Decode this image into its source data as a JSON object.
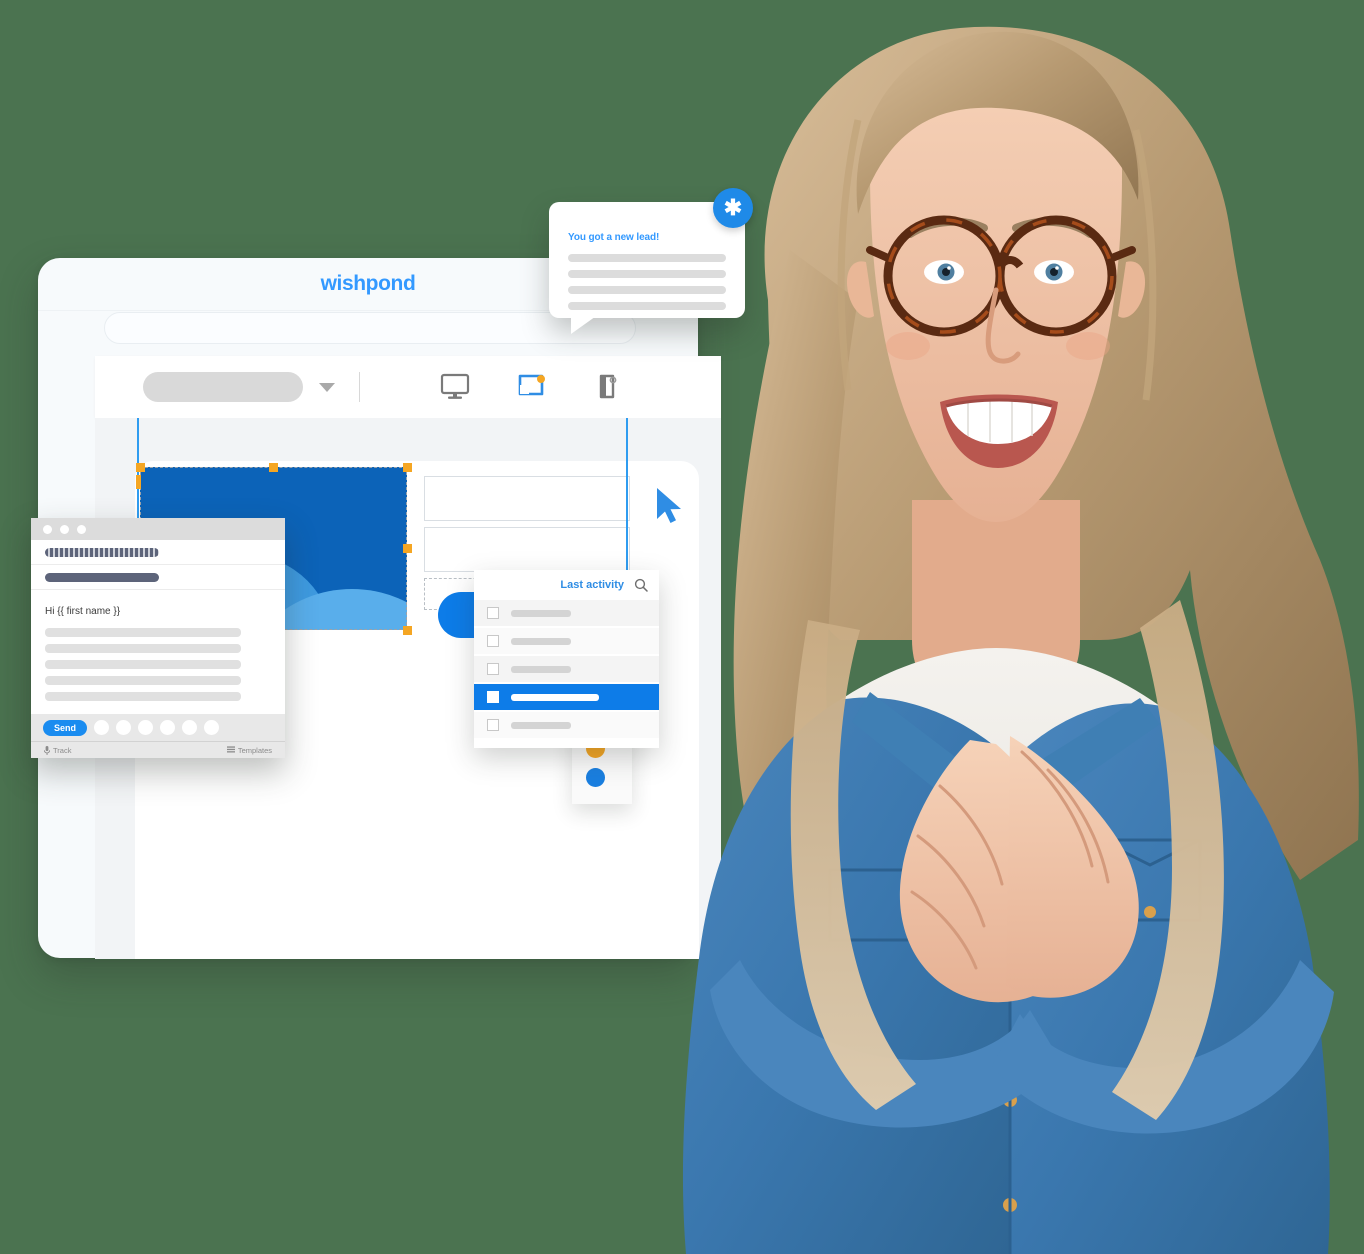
{
  "background_color": "#4b7350",
  "brand": {
    "name": "wishpond",
    "color": "#3399ff"
  },
  "main_window": {
    "logo": "wishpond",
    "url_placeholder": "",
    "toolbar": {
      "element_select_value": "",
      "chevron": "chevron-down-icon",
      "devices": [
        {
          "name": "desktop",
          "label": "Desktop",
          "active": false
        },
        {
          "name": "tablet",
          "label": "Tablet",
          "active": true
        },
        {
          "name": "mobile",
          "label": "Mobile",
          "active": false
        }
      ]
    },
    "canvas": {
      "selected_element": "image-block",
      "image_block_color": "#0c63b8",
      "handle_color": "#f5a623",
      "guide_color": "#2f9cf0",
      "form_fields": [
        "",
        ""
      ],
      "drop_zone_label": "",
      "cta_button_color": "#0d7ce8"
    }
  },
  "notification": {
    "title": "You got a new lead!",
    "badge_glyph": "✱",
    "badge_color": "#1f8ae8",
    "lines": 4
  },
  "email_composer": {
    "window_dots": 3,
    "header_rows": 2,
    "greeting": "Hi {{ first name }}",
    "body_lines": 5,
    "send_label": "Send",
    "tool_dots": 6,
    "footer": {
      "track_label": "Track",
      "track_icon": "microphone-icon",
      "templates_label": "Templates",
      "templates_icon": "templates-icon"
    }
  },
  "last_activity": {
    "title": "Last activity",
    "search_icon": "search-icon",
    "rows": [
      {
        "selected": false
      },
      {
        "selected": false
      },
      {
        "selected": false
      },
      {
        "selected": true
      },
      {
        "selected": false
      }
    ]
  },
  "dots_panel": {
    "dots": [
      {
        "color": "#1b5fb0"
      },
      {
        "color": "#f5a623"
      },
      {
        "color": "#1a7fe0"
      }
    ]
  },
  "cursor": {
    "name": "arrow-cursor",
    "color": "#2f8de4"
  },
  "portrait": {
    "subject": "smiling woman with glasses in denim jacket",
    "hair_color": "#c6a882",
    "denim_color": "#3d7bb5",
    "skin_color": "#f0c3a6"
  }
}
